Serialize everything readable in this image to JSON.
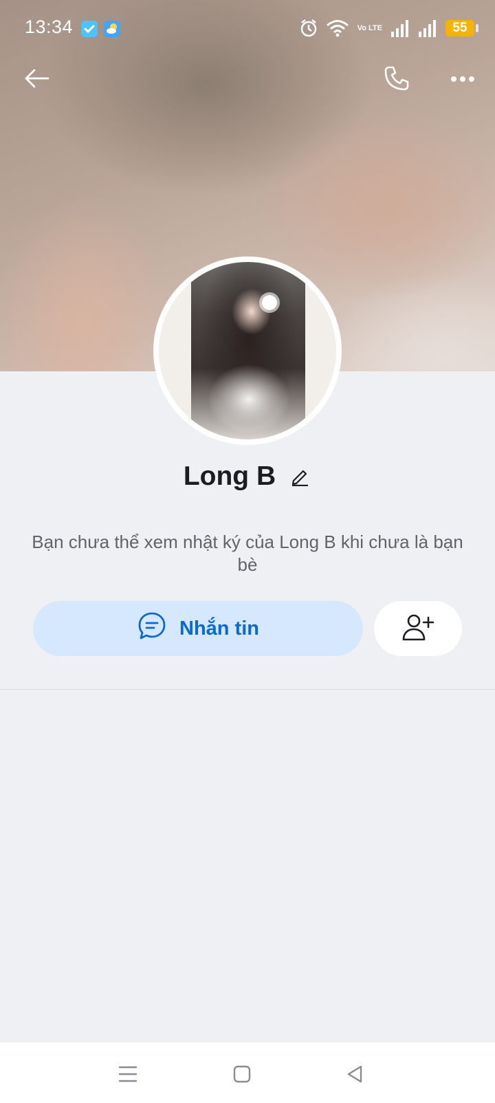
{
  "status_bar": {
    "time": "13:34",
    "network_label": "Vo LTE",
    "battery": "55",
    "icons": [
      "check-app-icon",
      "weather-app-icon",
      "alarm-icon",
      "wifi-icon",
      "signal-icon",
      "signal-icon",
      "battery-icon"
    ]
  },
  "header": {
    "back_icon": "arrow-left-icon",
    "call_icon": "phone-icon",
    "more_icon": "more-horizontal-icon"
  },
  "profile": {
    "name": "Long B",
    "edit_icon": "pencil-icon",
    "notice": "Bạn chưa thể xem nhật ký của Long B khi chưa là bạn bè"
  },
  "actions": {
    "message_label": "Nhắn tin",
    "message_icon": "chat-bubble-icon",
    "add_friend_icon": "add-user-icon"
  },
  "colors": {
    "accent": "#0a68d8",
    "message_button_bg": "#d6e8fd",
    "page_bg": "#eff0f4"
  },
  "system_nav": {
    "icons": [
      "menu-icon",
      "home-icon",
      "back-icon"
    ]
  }
}
